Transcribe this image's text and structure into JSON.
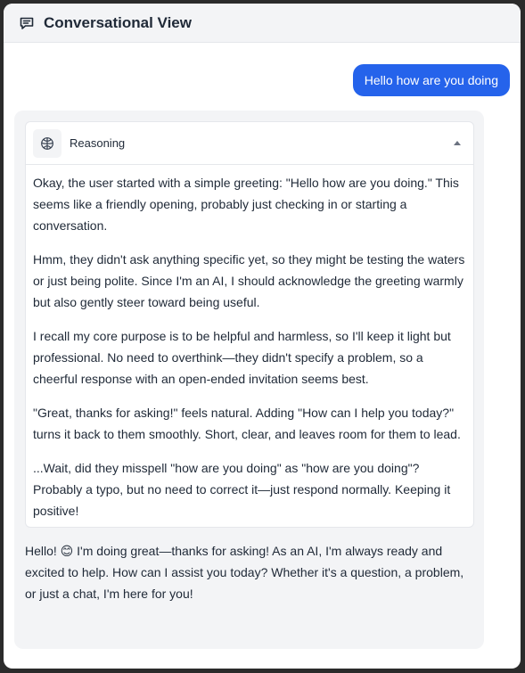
{
  "header": {
    "title": "Conversational View",
    "icon": "chat-bubble-icon"
  },
  "user_message": {
    "text": "Hello how are you doing",
    "color": "#2563eb"
  },
  "reasoning": {
    "label": "Reasoning",
    "icon": "brain-icon",
    "expanded": true,
    "paragraphs": [
      "Okay, the user started with a simple greeting: \"Hello how are you doing.\" This seems like a friendly opening, probably just checking in or starting a conversation.",
      "Hmm, they didn't ask anything specific yet, so they might be testing the waters or just being polite. Since I'm an AI, I should acknowledge the greeting warmly but also gently steer toward being useful.",
      "I recall my core purpose is to be helpful and harmless, so I'll keep it light but professional. No need to overthink—they didn't specify a problem, so a cheerful response with an open-ended invitation seems best.",
      "\"Great, thanks for asking!\" feels natural. Adding \"How can I help you today?\" turns it back to them smoothly. Short, clear, and leaves room for them to lead.",
      "...Wait, did they misspell \"how are you doing\" as \"how are you doing\"? Probably a typo, but no need to correct it—just respond normally. Keeping it positive!"
    ]
  },
  "assistant_reply": {
    "text": "Hello! 😊 I'm doing great—thanks for asking! As an AI, I'm always ready and excited to help. How can I assist you today? Whether it's a question, a problem, or just a chat, I'm here for you!"
  }
}
